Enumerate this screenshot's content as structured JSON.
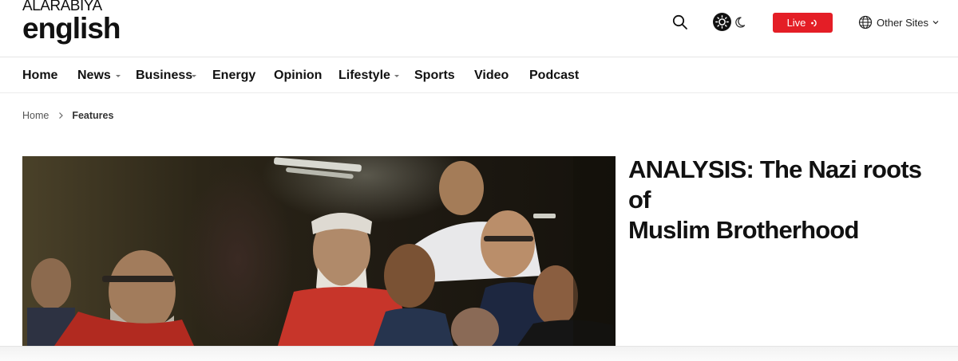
{
  "header": {
    "logo_top": "ALARABIYA",
    "logo_bottom": "english",
    "live_label": "Live",
    "other_sites_label": "Other Sites",
    "icons": {
      "search": "search-icon",
      "theme_light": "sun-icon",
      "theme_dark": "moon-icon",
      "live": "live-signal-icon",
      "globe": "globe-icon",
      "dropdown": "chevron-down-icon"
    },
    "live_color": "#e41e26"
  },
  "nav": {
    "items": [
      {
        "label": "Home",
        "has_dropdown": false
      },
      {
        "label": "News",
        "has_dropdown": true
      },
      {
        "label": "Business",
        "has_dropdown": true
      },
      {
        "label": "Energy",
        "has_dropdown": false
      },
      {
        "label": "Opinion",
        "has_dropdown": false
      },
      {
        "label": "Lifestyle",
        "has_dropdown": true
      },
      {
        "label": "Sports",
        "has_dropdown": false
      },
      {
        "label": "Video",
        "has_dropdown": false
      },
      {
        "label": "Podcast",
        "has_dropdown": false
      }
    ]
  },
  "breadcrumb": {
    "home": "Home",
    "current": "Features"
  },
  "article": {
    "headline_line1": "ANALYSIS: The Nazi roots of",
    "headline_line2": "Muslim Brotherhood"
  }
}
